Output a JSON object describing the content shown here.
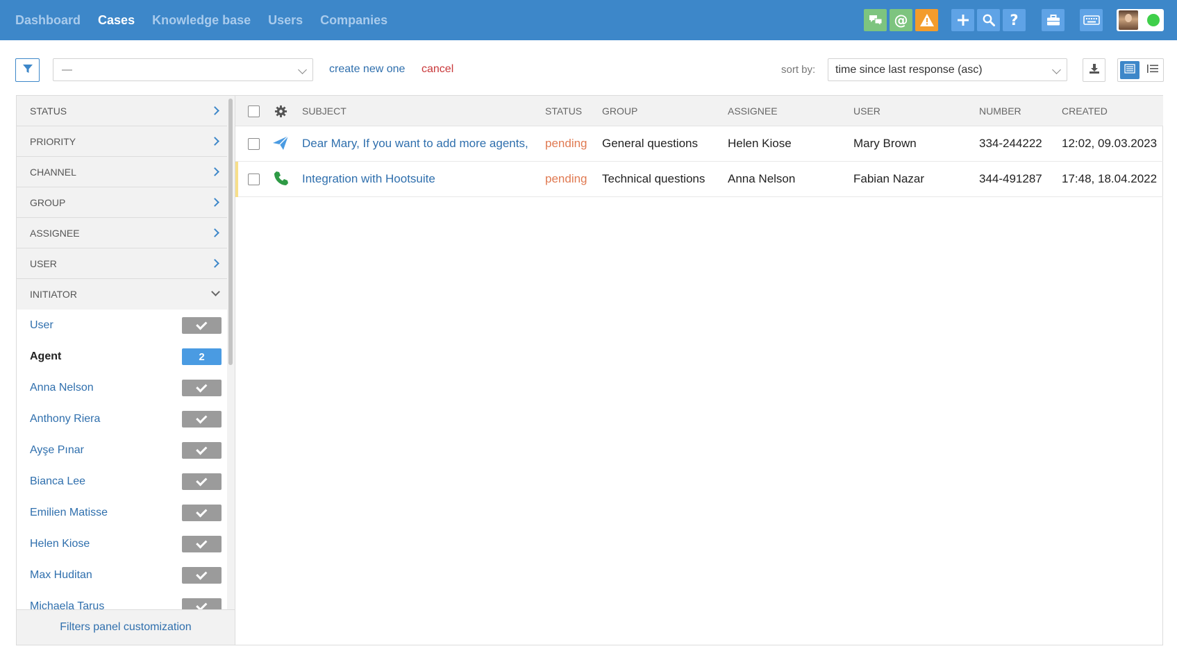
{
  "nav": {
    "items": [
      "Dashboard",
      "Cases",
      "Knowledge base",
      "Users",
      "Companies"
    ],
    "active": "Cases"
  },
  "toolbar_icons": [
    {
      "name": "chat-icon",
      "color": "#7dc47f"
    },
    {
      "name": "mention-icon",
      "color": "#7dc47f"
    },
    {
      "name": "warning-icon",
      "color": "#f39c2c"
    },
    {
      "name": "plus-icon",
      "color": "#5fa3e6"
    },
    {
      "name": "search-icon",
      "color": "#5fa3e6"
    },
    {
      "name": "help-icon",
      "color": "#5fa3e6"
    },
    {
      "name": "briefcase-icon",
      "color": "#5fa3e6"
    },
    {
      "name": "keyboard-icon",
      "color": "#5fa3e6"
    }
  ],
  "filter": {
    "selected": "—",
    "create_label": "create new one",
    "cancel_label": "cancel"
  },
  "sort": {
    "label": "sort by:",
    "value": "time since last response (asc)"
  },
  "sidebar": {
    "sections": [
      "STATUS",
      "PRIORITY",
      "CHANNEL",
      "GROUP",
      "ASSIGNEE",
      "USER"
    ],
    "open_section": "INITIATOR",
    "options": [
      {
        "label": "User",
        "state": "check"
      },
      {
        "label": "Agent",
        "state": "count",
        "count": "2",
        "bold": true
      },
      {
        "label": "Anna Nelson",
        "state": "check"
      },
      {
        "label": "Anthony Riera",
        "state": "check"
      },
      {
        "label": "Ayşe Pınar",
        "state": "check"
      },
      {
        "label": "Bianca Lee",
        "state": "check"
      },
      {
        "label": "Emilien Matisse",
        "state": "check"
      },
      {
        "label": "Helen Kiose",
        "state": "check"
      },
      {
        "label": "Max Huditan",
        "state": "check"
      },
      {
        "label": "Michaela Tarus",
        "state": "check"
      }
    ],
    "footer": "Filters panel customization"
  },
  "table": {
    "columns": [
      "SUBJECT",
      "STATUS",
      "GROUP",
      "ASSIGNEE",
      "USER",
      "NUMBER",
      "CREATED"
    ],
    "rows": [
      {
        "channel_icon": "send-icon",
        "subject": "Dear Mary, If you want to add more agents,",
        "status": "pending",
        "group": "General questions",
        "assignee": "Helen Kiose",
        "user": "Mary Brown",
        "number": "334-244222",
        "created": "12:02, 09.03.2023"
      },
      {
        "channel_icon": "phone-icon",
        "subject": "Integration with Hootsuite",
        "status": "pending",
        "group": "Technical questions",
        "assignee": "Anna Nelson",
        "user": "Fabian Nazar",
        "number": "344-491287",
        "created": "17:48, 18.04.2022"
      }
    ]
  }
}
